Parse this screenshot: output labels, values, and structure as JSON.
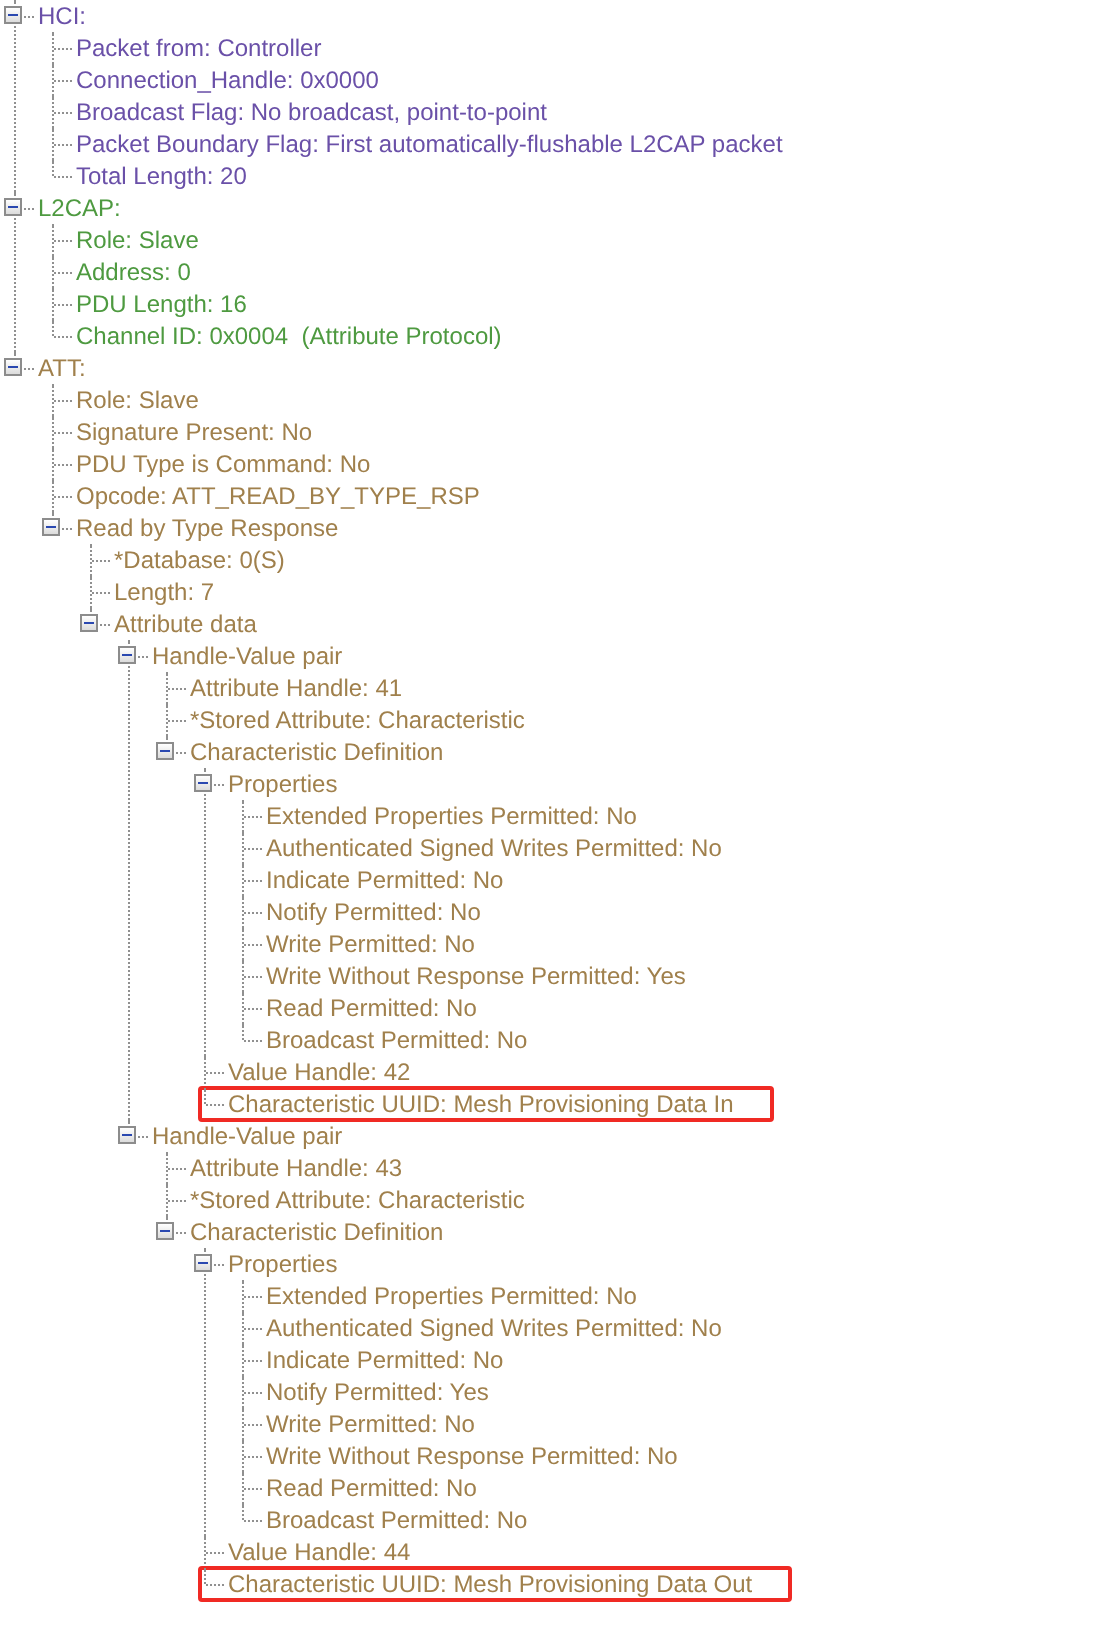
{
  "tree": [
    {
      "label": "HCI:",
      "color": "#6a50a8",
      "expanded": true,
      "children": [
        {
          "label": "Packet from: Controller"
        },
        {
          "label": "Connection_Handle: 0x0000"
        },
        {
          "label": "Broadcast Flag: No broadcast, point-to-point"
        },
        {
          "label": "Packet Boundary Flag: First automatically-flushable L2CAP packet"
        },
        {
          "label": "Total Length: 20"
        }
      ]
    },
    {
      "label": "L2CAP:",
      "color": "#4e9a40",
      "expanded": true,
      "children": [
        {
          "label": "Role: Slave"
        },
        {
          "label": "Address: 0"
        },
        {
          "label": "PDU Length: 16"
        },
        {
          "label": "Channel ID: 0x0004  (Attribute Protocol)"
        }
      ]
    },
    {
      "label": "ATT:",
      "color": "#a0804c",
      "expanded": true,
      "children": [
        {
          "label": "Role: Slave"
        },
        {
          "label": "Signature Present: No"
        },
        {
          "label": "PDU Type is Command: No"
        },
        {
          "label": "Opcode: ATT_READ_BY_TYPE_RSP"
        },
        {
          "label": "Read by Type Response",
          "expanded": true,
          "children": [
            {
              "label": "*Database: 0(S)"
            },
            {
              "label": "Length: 7"
            },
            {
              "label": "Attribute data",
              "expanded": true,
              "children": [
                {
                  "label": "Handle-Value pair",
                  "expanded": true,
                  "children": [
                    {
                      "label": "Attribute Handle: 41",
                      "highlighted": false
                    },
                    {
                      "label": "*Stored Attribute: Characteristic",
                      "highlighted": false
                    },
                    {
                      "label": "Characteristic Definition",
                      "highlighted": false,
                      "expanded": true,
                      "children": [
                        {
                          "label": "Properties",
                          "expanded": true,
                          "children": [
                            {
                              "label": "Extended Properties Permitted: No"
                            },
                            {
                              "label": "Authenticated Signed Writes Permitted: No"
                            },
                            {
                              "label": "Indicate Permitted: No"
                            },
                            {
                              "label": "Notify Permitted: No"
                            },
                            {
                              "label": "Write Permitted: No"
                            },
                            {
                              "label": "Write Without Response Permitted: Yes"
                            },
                            {
                              "label": "Read Permitted: No"
                            },
                            {
                              "label": "Broadcast Permitted: No"
                            }
                          ]
                        },
                        {
                          "label": "Value Handle: 42"
                        },
                        {
                          "label": "Characteristic UUID: Mesh Provisioning Data In",
                          "highlighted": true
                        }
                      ]
                    }
                  ]
                },
                {
                  "label": "Handle-Value pair",
                  "expanded": true,
                  "children": [
                    {
                      "label": "Attribute Handle: 43",
                      "highlighted": false
                    },
                    {
                      "label": "*Stored Attribute: Characteristic",
                      "highlighted": false
                    },
                    {
                      "label": "Characteristic Definition",
                      "highlighted": false,
                      "expanded": true,
                      "children": [
                        {
                          "label": "Properties",
                          "expanded": true,
                          "children": [
                            {
                              "label": "Extended Properties Permitted: No"
                            },
                            {
                              "label": "Authenticated Signed Writes Permitted: No"
                            },
                            {
                              "label": "Indicate Permitted: No"
                            },
                            {
                              "label": "Notify Permitted: Yes"
                            },
                            {
                              "label": "Write Permitted: No"
                            },
                            {
                              "label": "Write Without Response Permitted: No"
                            },
                            {
                              "label": "Read Permitted: No"
                            },
                            {
                              "label": "Broadcast Permitted: No"
                            }
                          ]
                        },
                        {
                          "label": "Value Handle: 44"
                        },
                        {
                          "label": "Characteristic UUID: Mesh Provisioning Data Out",
                          "highlighted": true
                        }
                      ]
                    }
                  ]
                }
              ]
            }
          ]
        }
      ]
    }
  ]
}
